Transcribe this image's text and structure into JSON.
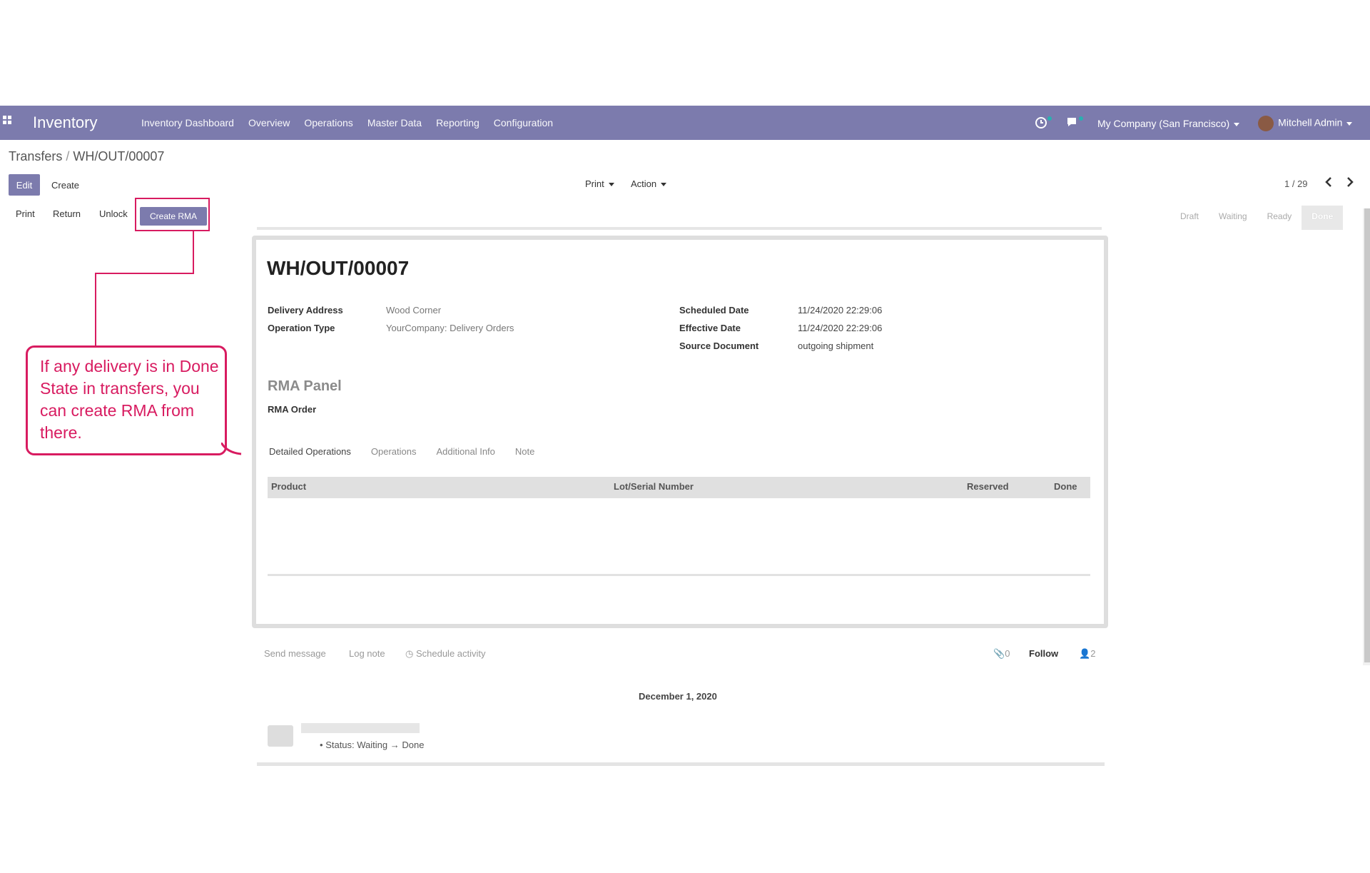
{
  "navbar": {
    "app_name": "Inventory",
    "menu": [
      "Inventory Dashboard",
      "Overview",
      "Operations",
      "Master Data",
      "Reporting",
      "Configuration"
    ],
    "company": "My Company (San Francisco)",
    "user": "Mitchell Admin",
    "accent_color": "#7c7bad"
  },
  "breadcrumb": {
    "parent": "Transfers",
    "separator": "/",
    "current": "WH/OUT/00007"
  },
  "toolbar": {
    "edit_label": "Edit",
    "create_label": "Create",
    "print_label": "Print",
    "action_label": "Action",
    "pager": "1 / 29"
  },
  "statusbar": {
    "print_label": "Print",
    "return_label": "Return",
    "unlock_label": "Unlock",
    "create_rma_label": "Create RMA",
    "states": [
      "Draft",
      "Waiting",
      "Ready",
      "Done"
    ],
    "active_state": "Done"
  },
  "form": {
    "title": "WH/OUT/00007",
    "delivery_address_label": "Delivery Address",
    "delivery_address_value": "Wood Corner",
    "operation_type_label": "Operation Type",
    "operation_type_value": "YourCompany: Delivery Orders",
    "scheduled_date_label": "Scheduled Date",
    "scheduled_date_value": "11/24/2020 22:29:06",
    "effective_date_label": "Effective Date",
    "effective_date_value": "11/24/2020 22:29:06",
    "source_document_label": "Source Document",
    "source_document_value": "outgoing shipment",
    "rma_panel_title": "RMA Panel",
    "rma_order_label": "RMA Order",
    "tabs": [
      "Detailed Operations",
      "Operations",
      "Additional Info",
      "Note"
    ],
    "table_columns": [
      "Product",
      "Lot/Serial Number",
      "Reserved",
      "Done"
    ]
  },
  "chatter": {
    "send_message": "Send message",
    "log_note": "Log note",
    "schedule_activity": "Schedule activity",
    "attachments": "0",
    "follow": "Follow",
    "followers": "2",
    "date": "December 1, 2020",
    "status_change": "Status: Waiting → Done"
  },
  "annotation": {
    "text": "If any delivery is in Done State in transfers, you can create RMA from there.",
    "color": "#d81b60"
  }
}
